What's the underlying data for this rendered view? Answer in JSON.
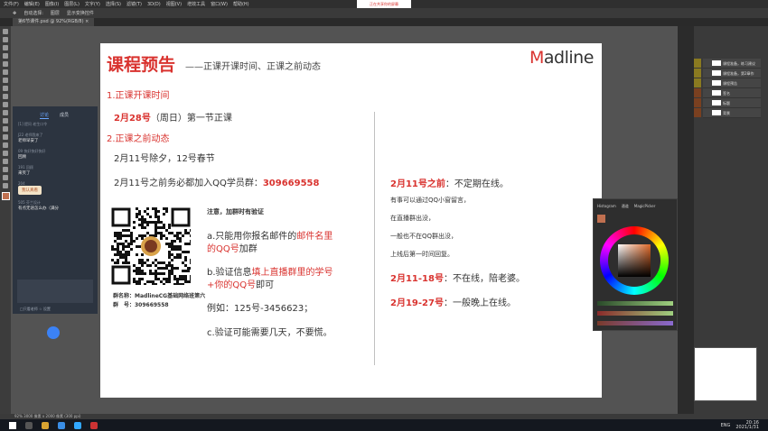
{
  "app": {
    "menus": [
      "文件(F)",
      "编辑(E)",
      "图像(I)",
      "图层(L)",
      "文字(Y)",
      "选择(S)",
      "滤镜(T)",
      "3D(D)",
      "视图(V)",
      "增效工具",
      "窗口(W)",
      "帮助(H)"
    ],
    "options": [
      "自动选择:",
      "图层",
      "显示变换控件"
    ],
    "doc_tab": "第6节课件.psd @ 92%(RGB/8) ×",
    "status": "92%   3000 像素 x 2000 像素 (300 ppi)",
    "sharing_badge": "正在共享你的屏幕"
  },
  "chat": {
    "tabs": [
      "讨论",
      "成员"
    ],
    "messages": [
      {
        "name": "[1] 提问 老生口令",
        "text": ""
      },
      {
        "name": "J22 老师我来了",
        "text": "老师早安了"
      },
      {
        "name": "09 快好快好快好",
        "text": "回顾"
      },
      {
        "name": "191 回顾",
        "text": "来笑了"
      },
      {
        "name": "204",
        "text": "我认真看"
      },
      {
        "name": "505 芬兰设计",
        "text": "有点无语怎么办（满分"
      }
    ],
    "footer": "□只看老师   ☆ 设置"
  },
  "slide": {
    "title": "课程预告",
    "subtitle": "——正课开课时间、正课之前动态",
    "logo_m": "M",
    "logo_rest": "adline",
    "section1": "1.正课开课时间",
    "date_main": "2月28号",
    "date_rest": "（周日）第一节正课",
    "section2": "2.正课之前动态",
    "line_holiday": "2月11号除夕，12号春节",
    "line_join_prefix": "2月11号之前务必都加入QQ学员群：",
    "line_join_number": "309669558",
    "notice": "注意，加群时有验证",
    "step_a_1": "a.只能用你报名邮件的",
    "step_a_red": "邮件名里",
    "step_a_2": "的QQ号",
    "step_a_3": "加群",
    "step_b_1": "b.验证信息",
    "step_b_red1": "填上直播群里的学号",
    "step_b_red2": "+你的QQ号",
    "step_b_2": "即可",
    "example": "例如：125号-3456623；",
    "step_c": "c.验证可能需要几天，不要慌。",
    "qr_group_name": "群名称：MadlineCG基础网络班第六",
    "qr_group_no": "群　号：309669558",
    "r_title_red": "2月11号之前",
    "r_title_rest": "：不定期在线。",
    "r_line1": "有事可以通过QQ小窗留言，",
    "r_line2": "在直播群出没，",
    "r_line3": "一般也不在QQ群出没，",
    "r_line4": "上线后第一时间回复。",
    "r_mid_red": "2月11-18号",
    "r_mid_rest": "：不在线，陪老婆。",
    "r_last_red": "2月19-27号",
    "r_last_rest": "：一般晚上在线。"
  },
  "layers": [
    "课程准备，练习建议",
    "课程准备，第2章作",
    "课程预告",
    "签名",
    "标题",
    "背景"
  ],
  "color_panel": {
    "tabs": [
      "Histogram",
      "通道",
      "MagicPicker"
    ]
  },
  "taskbar": {
    "lang": "ENG",
    "time": "20:16",
    "date": "2021/1/31"
  },
  "colors": {
    "accent_red": "#d9332f",
    "ps_dark": "#535353"
  }
}
